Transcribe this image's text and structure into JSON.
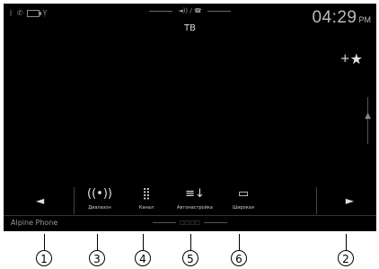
{
  "status": {
    "icons": [
      "bluetooth-icon",
      "phone-icon",
      "battery-icon",
      "signal-icon"
    ],
    "center": "◄)) / ☎"
  },
  "source": "ТВ",
  "clock": {
    "time": "04:29",
    "ampm": "PM"
  },
  "favorite": {
    "plus": "+",
    "star": "★"
  },
  "toolbar": {
    "left_arrow": "◄",
    "right_arrow": "►",
    "buttons": [
      {
        "id": "diapazon",
        "icon": "((•))",
        "label": "Диапазон"
      },
      {
        "id": "kanal",
        "icon": "⣿",
        "label": "Канал"
      },
      {
        "id": "autonastroika",
        "icon": "≡↓",
        "label": "Автонастройка"
      },
      {
        "id": "shirokaya",
        "icon": "▭",
        "label": "Широкая"
      }
    ]
  },
  "bottom": {
    "text": "Alpine Phone",
    "dots": "□□□□"
  },
  "callouts": [
    "1",
    "3",
    "4",
    "5",
    "6",
    "2"
  ]
}
